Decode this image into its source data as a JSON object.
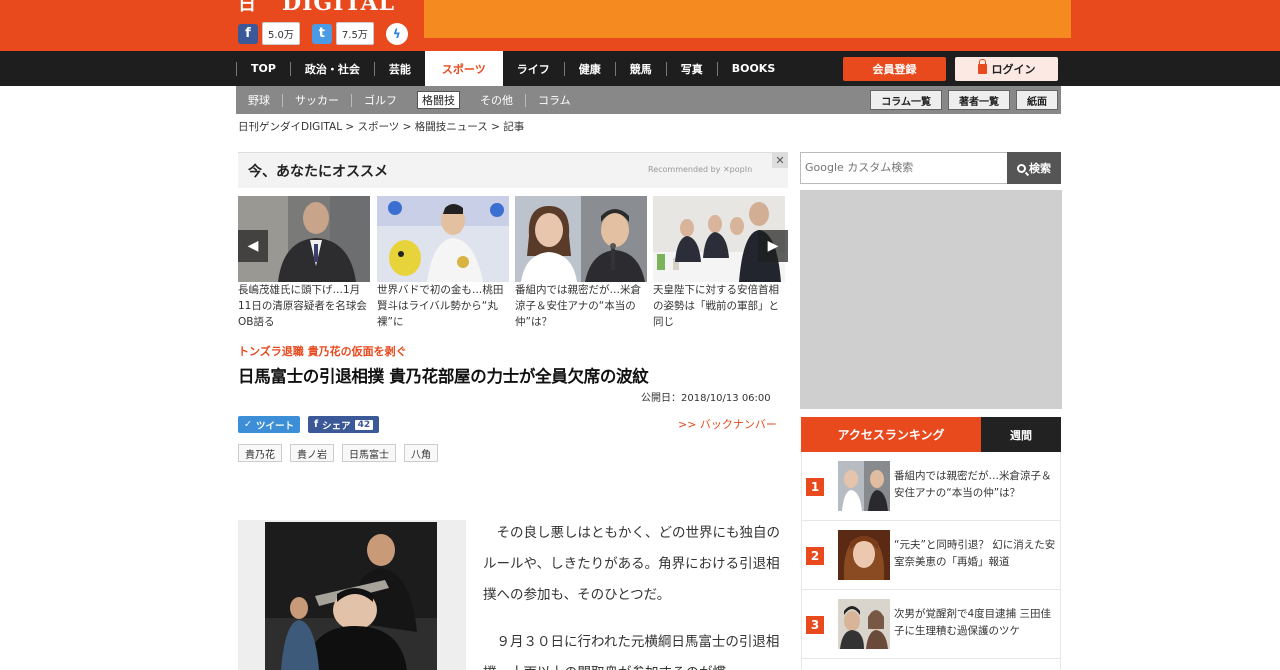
{
  "header": {
    "logo_mark": "日",
    "logo_text": "DIGITAL",
    "fb_count": "5.0万",
    "tw_count": "7.5万"
  },
  "nav": {
    "items": [
      "TOP",
      "政治・社会",
      "芸能",
      "スポーツ",
      "ライフ",
      "健康",
      "競馬",
      "写真",
      "BOOKS"
    ],
    "active_index": 3,
    "register_label": "会員登録",
    "login_label": "ログイン"
  },
  "subnav": {
    "items": [
      "野球",
      "サッカー",
      "ゴルフ",
      "格闘技",
      "その他",
      "コラム"
    ],
    "active_index": 3,
    "buttons": [
      "コラム一覧",
      "著者一覧",
      "紙面"
    ]
  },
  "breadcrumb": "日刊ゲンダイDIGITAL > スポーツ > 格闘技ニュース > 記事",
  "recommend": {
    "title": "今、あなたにオススメ",
    "by": "Recommended by ✕popIn",
    "close": "✕",
    "cards": [
      {
        "text": "長嶋茂雄氏に頭下げ…1月11日の清原容疑者を名球会OB語る"
      },
      {
        "text": "世界バドで初の金も…桃田賢斗はライバル勢から“丸裸”に"
      },
      {
        "text": "番組内では親密だが…米倉涼子＆安住アナの“本当の仲”は？"
      },
      {
        "text": "天皇陛下に対する安倍首相の姿勢は「戦前の軍部」と同じ"
      }
    ]
  },
  "article": {
    "kicker": "トンズラ退職 貴乃花の仮面を剥ぐ",
    "headline": "日馬富士の引退相撲 貴乃花部屋の力士が全員欠席の波紋",
    "published": "公開日：2018/10/13 06:00",
    "tweet_label": "ツイート",
    "share_label": "シェア",
    "share_count": "42",
    "back_number": ">> バックナンバー",
    "tags": [
      "貴乃花",
      "貴ノ岩",
      "日馬富士",
      "八角"
    ],
    "paragraphs": [
      "その良し悪しはともかく、どの世界にも独自のルールや、しきたりがある。角界における引退相撲への参加も、そのひとつだ。",
      "９月３０日に行われた元横綱日馬富士の引退相撲。十両以上の関取衆が参加するのが慣"
    ]
  },
  "sidebar": {
    "search_placeholder": "Google カスタム検索",
    "search_button": "検索",
    "ranking_tab": "アクセスランキング",
    "weekly_tab": "週間",
    "ranking": [
      {
        "num": "1",
        "text": "番組内では親密だが…米倉涼子＆安住アナの“本当の仲”は？"
      },
      {
        "num": "2",
        "text": "“元夫”と同時引退？ 幻に消えた安室奈美恵の「再婚」報道"
      },
      {
        "num": "3",
        "text": "次男が覚醒剤で4度目逮捕 三田佳子に生理積む過保護のツケ"
      }
    ]
  },
  "colors": {
    "brand": "#e8491d",
    "nav_bg": "#1e1e1e",
    "subnav_bg": "#888888"
  }
}
